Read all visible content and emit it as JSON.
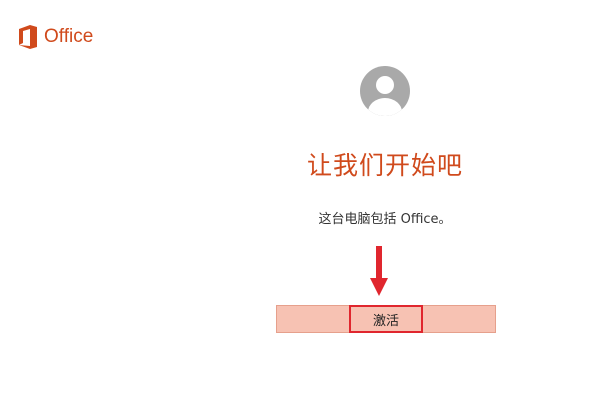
{
  "brand": {
    "name": "Office",
    "icon": "office-logo-icon",
    "color": "#d04a1c"
  },
  "account": {
    "avatar_icon": "user-avatar-icon"
  },
  "main": {
    "title": "让我们开始吧",
    "description": "这台电脑包括 Office。",
    "activate_label": "激活",
    "annotation_icon": "red-arrow-down-icon"
  },
  "colors": {
    "accent": "#d04a1c",
    "highlight_border": "#e0262e",
    "button_fill": "#f7c2b3"
  }
}
